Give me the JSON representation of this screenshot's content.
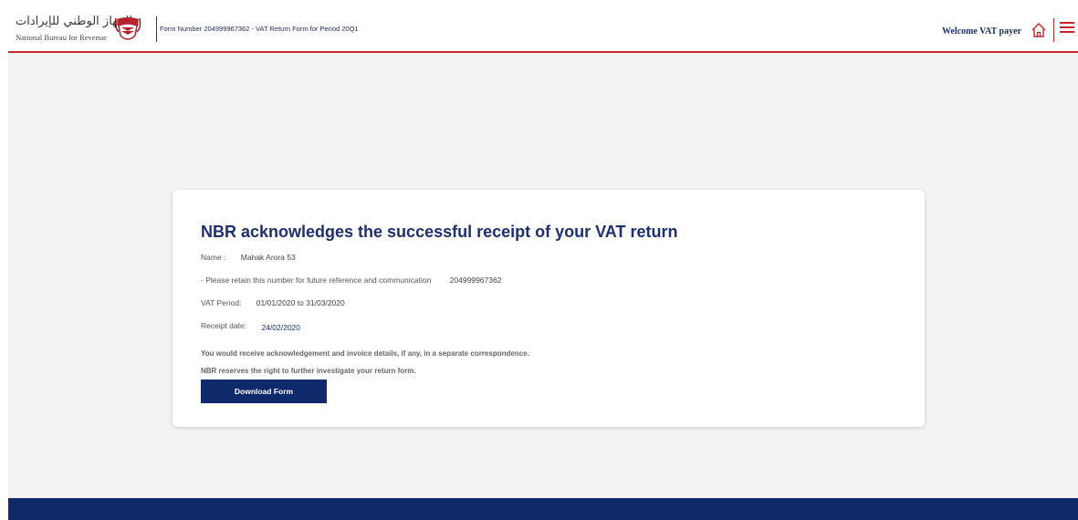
{
  "header": {
    "logo_arabic": "الجهاز الوطني للإيرادات",
    "logo_english": "National Bureau for Revenue",
    "form_title": "Form Number 204999967362 - VAT Return Form for Period 20Q1",
    "welcome": "Welcome VAT payer",
    "home_icon": "home-icon",
    "menu_icon": "hamburger-menu-icon"
  },
  "card": {
    "title": "NBR acknowledges the successful receipt of your VAT return",
    "name_label": "Name :",
    "name_value": "Mahak Arora 53",
    "reference_label": "- Please retain this number for future reference and communication",
    "reference_value": "204999967362",
    "period_label": "VAT Period:",
    "period_value": "01/01/2020 to 31/03/2020",
    "receipt_label": "Receipt date:",
    "receipt_value": "24/02/2020",
    "note_1": "You would receive acknowledgement and invoice details, if any, in a separate correspondence.",
    "note_2": "NBR reserves the right to further investigate your return form.",
    "download_label": "Download Form"
  },
  "colors": {
    "brand_navy": "#0f2a6b",
    "accent_red": "#c8252c",
    "background": "#f3f3f4"
  }
}
